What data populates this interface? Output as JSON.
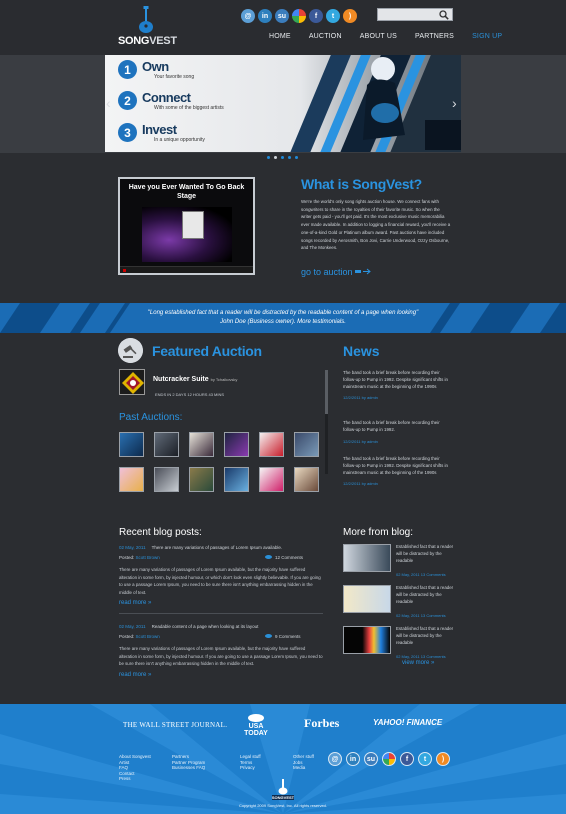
{
  "brand": {
    "name_part1": "SONG",
    "name_part2": "VEST"
  },
  "nav": [
    "HOME",
    "AUCTION",
    "ABOUT US",
    "PARTNERS",
    "SIGN UP"
  ],
  "social_icons": [
    "email-icon",
    "linkedin-icon",
    "stumbleupon-icon",
    "google-icon",
    "facebook-icon",
    "twitter-icon",
    "rss-icon"
  ],
  "search": {
    "placeholder": ""
  },
  "hero": {
    "steps": [
      {
        "num": "1",
        "title": "Own",
        "sub": "Your favorite song"
      },
      {
        "num": "2",
        "title": "Connect",
        "sub": "With some of the biggest artists"
      },
      {
        "num": "3",
        "title": "Invest",
        "sub": "In a unique opportunity"
      }
    ],
    "prev": "‹",
    "next": "›"
  },
  "video": {
    "title": "Have you Ever Wanted To Go Back Stage"
  },
  "whatis": {
    "title": "What is SongVest?",
    "body": "We're the world's only song rights auction house. We connect fans with songwriters to share in the royalties of their favorite music. So when the writer gets paid - you'll get paid. It's the most exclusive music memorabilia ever made available. In addition to logging a financial reward, you'll receive a one-of-a-kind Gold or Platinum album award. Past auctions have included songs recorded by Aerosmith, Bon Jovi, Carrie Underwood, Ozzy Osbourne, and The Monkees.",
    "cta": "go to auction"
  },
  "testimonial": {
    "quote": "\"Long established fact that a reader will be distracted by the readable content of a page when looking\"",
    "author": "John Doe (Business owner). More testimonials."
  },
  "featured": {
    "title": "Featured Auction",
    "item_title": "Nutcracker Suite",
    "item_by": "by Tchaikovsky",
    "ends": "ENDS IN 2 DAYS 12 HOURS 43 MINS",
    "past_title": "Past Auctions:"
  },
  "news": {
    "title": "News",
    "items": [
      {
        "text": "The band took a brief break before recording their follow-up to Pump in 1992. Despite significant shifts in mainstream music at the beginning of the 1990s",
        "date": "12/2/2011 by admin"
      },
      {
        "text": "The band took a brief break before recording their follow-up to Pump in 1992.",
        "date": "12/2/2011 by admin"
      },
      {
        "text": "The band took a brief break before recording their follow-up to Pump in 1992. Despite significant shifts in mainstream music at the beginning of the 1990s",
        "date": "12/2/2011 by admin"
      }
    ]
  },
  "blog": {
    "title": "Recent blog posts:",
    "posts": [
      {
        "date": "02 May, 2011",
        "title": "There are many variations of passages of Lorem Ipsum available.",
        "posted_label": "Posted:",
        "author": "Scott Brown",
        "comments": "12 Comments",
        "body": "There are many variations of passages of Lorem Ipsum available, but the majority have suffered alteration in some form, by injected humour, or which don't look even slightly believable. If you are going to use a passage Lorem Ipsum, you need to be sure there isn't anything embarrassing hidden in the middle of text.",
        "read_more": "read more"
      },
      {
        "date": "02 May, 2011",
        "title": "Readable content of a page when looking at its layout",
        "posted_label": "Posted:",
        "author": "Scott Brown",
        "comments": "9 Comments",
        "body": "There are many variations of passages of Lorem Ipsum available, but the majority have suffered alteration in some form, by injected humour. If you are going to use a passage Lorem Ipsum, you need to be sure there isn't anything embarrassing hidden in the middle of text.",
        "read_more": "read more"
      }
    ]
  },
  "more_blog": {
    "title": "More from blog:",
    "items": [
      {
        "text": "Established fact that a reader will be distracted by the readable",
        "date": "02 May, 2011 13 Comments"
      },
      {
        "text": "Established fact that a reader will be distracted by the readable",
        "date": "02 May, 2011 13 Comments"
      },
      {
        "text": "Established fact that a reader will be distracted by the readable",
        "date": "02 May, 2011 13 Comments"
      }
    ],
    "view_more": "view more"
  },
  "press": [
    "THE WALL STREET JOURNAL.",
    "USA TODAY",
    "Forbes",
    "YAHOO! FINANCE"
  ],
  "footer": {
    "cols": [
      [
        "About Songvest",
        "Artist",
        "FAQ",
        "Contact",
        "Press"
      ],
      [
        "Partners",
        "Partner Program",
        "Businesses FAQ"
      ],
      [
        "Legal stuff",
        "Terms",
        "Privacy"
      ],
      [
        "Other stuff",
        "Jobs",
        "Media"
      ]
    ],
    "copyright": "Copyright 2009 SongVest, Inc. All rights reserved."
  }
}
